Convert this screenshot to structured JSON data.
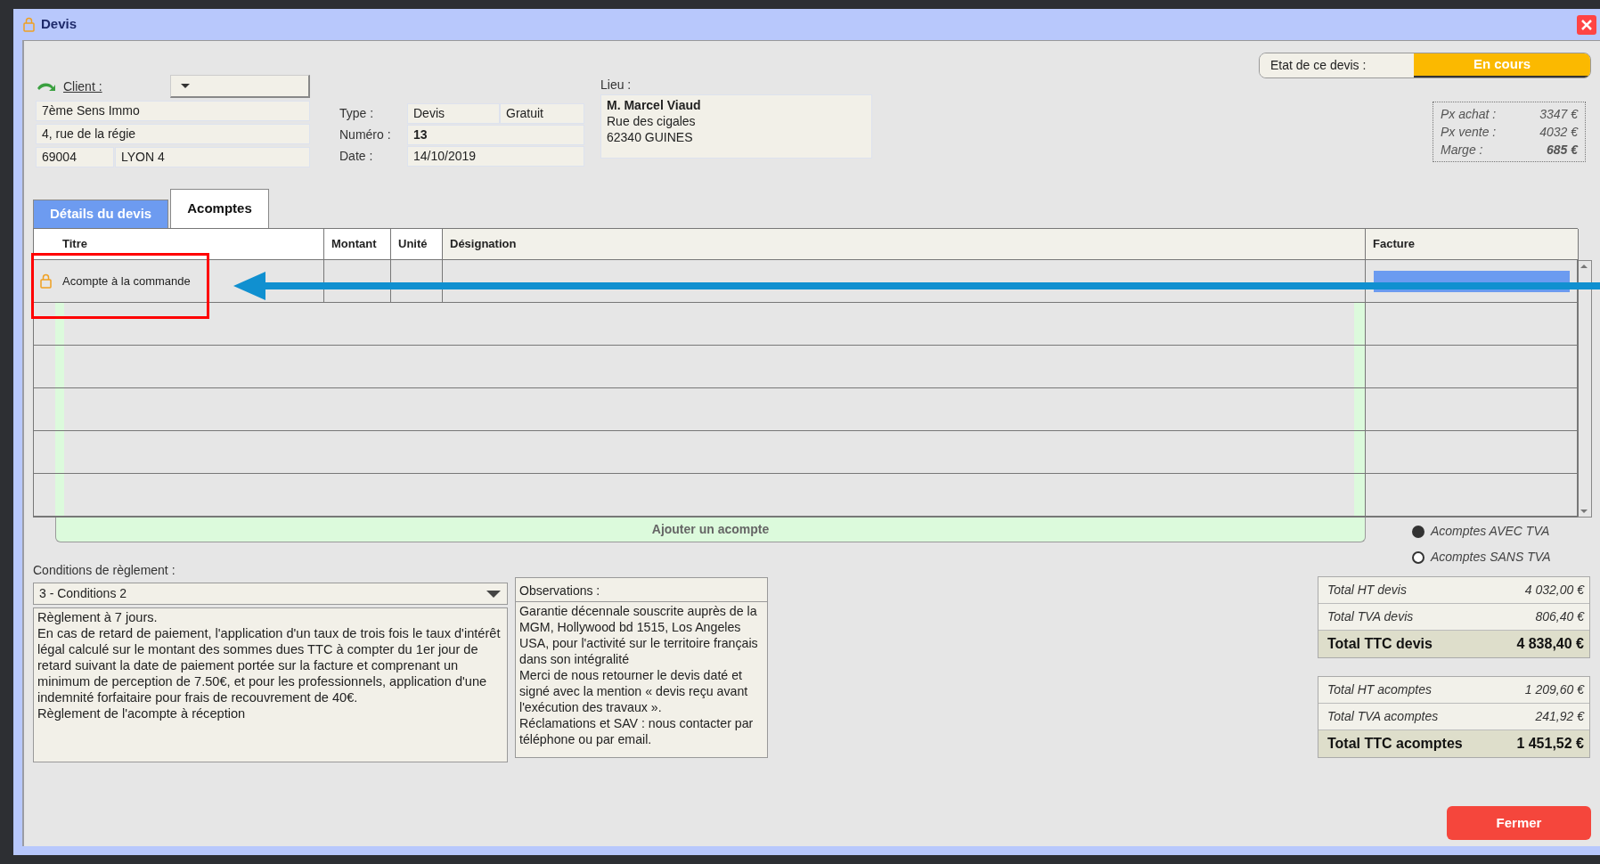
{
  "window": {
    "title": "Devis"
  },
  "client": {
    "label": "Client :",
    "name": "7ème Sens Immo",
    "address": "4, rue de la régie",
    "postcode": "69004",
    "city": "LYON 4"
  },
  "document_fields": [
    {
      "label": "Type :",
      "values": [
        "Devis",
        "Gratuit"
      ],
      "bold": false
    },
    {
      "label": "Numéro :",
      "values": [
        "13"
      ],
      "bold": true
    },
    {
      "label": "Date :",
      "values": [
        "14/10/2019"
      ],
      "bold": false
    }
  ],
  "lieu": {
    "label": "Lieu :",
    "name": "M. Marcel Viaud",
    "lines": [
      "Rue des cigales",
      "62340 GUINES"
    ]
  },
  "status": {
    "label": "Etat de ce devis :",
    "value": "En cours"
  },
  "prices": [
    {
      "label": "Px achat :",
      "value": "3347 €",
      "bold": false
    },
    {
      "label": "Px vente :",
      "value": "4032 €",
      "bold": false
    },
    {
      "label": "Marge :",
      "value": "685 €",
      "bold": true
    }
  ],
  "tabs": [
    {
      "label": "Détails du devis",
      "selected": false
    },
    {
      "label": "Acomptes",
      "selected": true
    }
  ],
  "table": {
    "columns": [
      "Titre",
      "Montant",
      "Unité",
      "Désignation",
      "Facture"
    ],
    "rows": [
      {
        "locked": true,
        "titre": "Acompte à la commande",
        "invoiced": true
      }
    ]
  },
  "add_button": "Ajouter un acompte",
  "tva_options": [
    {
      "label": "Acomptes AVEC TVA",
      "selected": true
    },
    {
      "label": "Acomptes SANS TVA",
      "selected": false
    }
  ],
  "conditions": {
    "label": "Conditions de règlement :",
    "selected": "3 - Conditions 2",
    "paragraphs": [
      "Règlement à 7 jours.",
      "En cas de retard de paiement, l'application d'un taux de trois fois le taux d'intérêt légal calculé sur le montant des sommes dues TTC à compter du 1er jour de retard suivant la date de paiement portée sur la facture et comprenant un minimum de perception de 7.50€, et pour les professionnels, application d'une indemnité forfaitaire pour frais de recouvrement de 40€.",
      "Règlement de l'acompte à réception"
    ]
  },
  "observations": {
    "label": "Observations :",
    "paragraphs": [
      "Garantie décennale souscrite auprès de la MGM, Hollywood bd 1515, Los Angeles USA, pour l'activité sur le territoire français dans son intégralité",
      "Merci de nous retourner le devis daté et signé avec la mention « devis reçu avant l'exécution des travaux ».",
      "Réclamations et SAV : nous contacter par téléphone ou par email."
    ]
  },
  "totals_devis": [
    {
      "label": "Total HT devis",
      "value": "4 032,00 €",
      "kind": "subtotal"
    },
    {
      "label": "Total TVA devis",
      "value": "806,40 €",
      "kind": "subtotal"
    },
    {
      "label": "Total TTC devis",
      "value": "4 838,40 €",
      "kind": "total"
    }
  ],
  "totals_acomptes": [
    {
      "label": "Total HT acomptes",
      "value": "1 209,60 €",
      "kind": "subtotal"
    },
    {
      "label": "Total TVA acomptes",
      "value": "241,92 €",
      "kind": "subtotal"
    },
    {
      "label": "Total TTC acomptes",
      "value": "1 451,52 €",
      "kind": "total"
    }
  ],
  "close_button": "Fermer"
}
